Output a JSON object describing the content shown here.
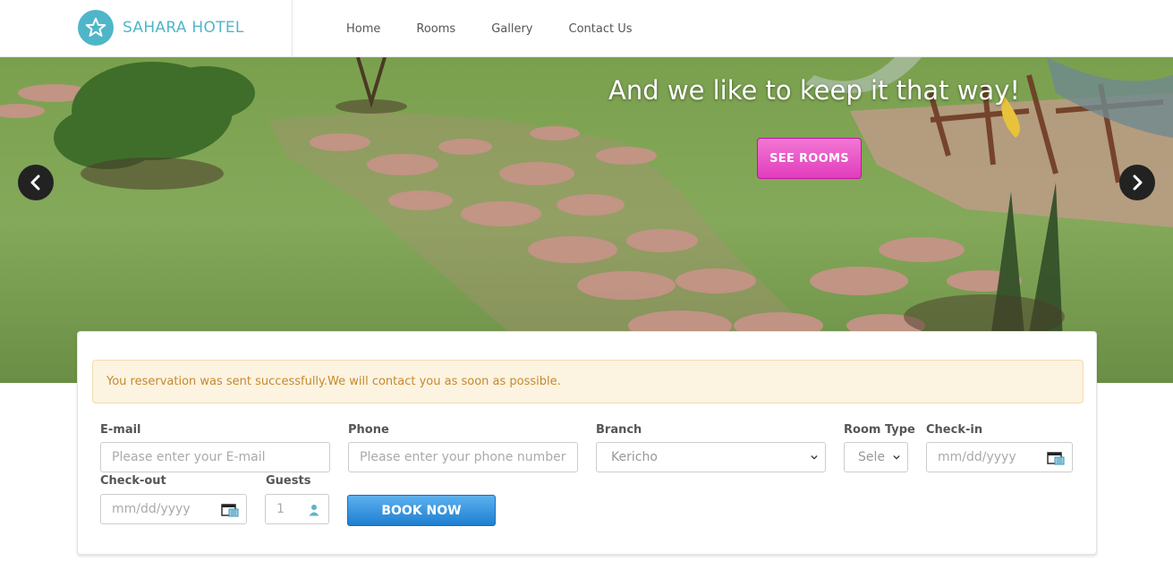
{
  "brand": {
    "name": "SAHARA HOTEL",
    "logo_icon": "star-icon",
    "accent": "#4fb6c9"
  },
  "nav": {
    "items": [
      {
        "label": "Home"
      },
      {
        "label": "Rooms"
      },
      {
        "label": "Gallery"
      },
      {
        "label": "Contact Us"
      }
    ]
  },
  "hero": {
    "tagline": "And we like to keep it that way!",
    "cta_label": "SEE ROOMS",
    "cta_color": "#e23cbd",
    "prev_icon": "chevron-left-icon",
    "next_icon": "chevron-right-icon"
  },
  "booking": {
    "alert": "You reservation was sent successfully.We will contact you as soon as possible.",
    "email": {
      "label": "E-mail",
      "placeholder": "Please enter your E-mail"
    },
    "phone": {
      "label": "Phone",
      "placeholder": "Please enter your phone number"
    },
    "branch": {
      "label": "Branch",
      "value": "Kericho"
    },
    "room_type": {
      "label": "Room Type",
      "value": "Sele"
    },
    "checkin": {
      "label": "Check-in",
      "placeholder": "mm/dd/yyyy"
    },
    "checkout": {
      "label": "Check-out",
      "placeholder": "mm/dd/yyyy"
    },
    "guests": {
      "label": "Guests",
      "placeholder": "1"
    },
    "submit_label": "BOOK NOW",
    "submit_color": "#1f7fd0"
  }
}
